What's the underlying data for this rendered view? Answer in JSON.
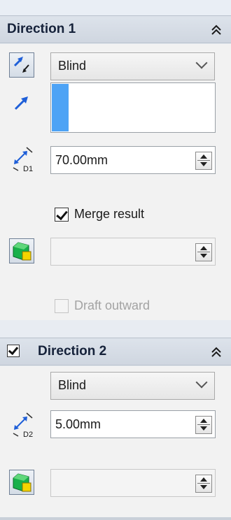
{
  "direction1": {
    "title": "Direction 1",
    "end_condition": "Blind",
    "depth": "70.00mm",
    "merge_result_label": "Merge result",
    "merge_result_checked": true,
    "draft_value": "",
    "draft_outward_label": "Draft outward",
    "draft_outward_checked": false
  },
  "direction2": {
    "title": "Direction 2",
    "enabled": true,
    "end_condition": "Blind",
    "depth": "5.00mm",
    "draft_value": ""
  },
  "icons": {
    "reverse_direction": "reverse-direction-icon",
    "direction_vector": "direction-arrow-icon",
    "depth_d1": "depth-d1-icon",
    "depth_d2": "depth-d2-icon",
    "draft": "draft-icon",
    "collapse": "collapse-chevron-icon"
  },
  "colors": {
    "selection_highlight": "#4da3f5",
    "arrow_blue": "#1f5fd8",
    "draft_green": "#18b04a",
    "draft_yellow": "#f5d400"
  }
}
